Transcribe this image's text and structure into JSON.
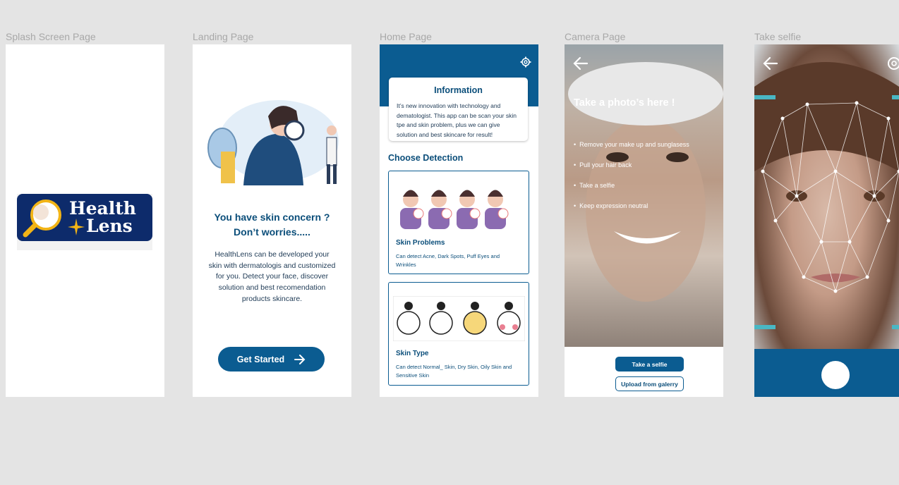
{
  "frames": {
    "splash": {
      "label": "Splash Screen Page",
      "logo_line1": "Health",
      "logo_line2": "Lens"
    },
    "landing": {
      "label": "Landing Page",
      "title_line1": "You have skin concern ?",
      "title_line2": "Don’t worries.....",
      "description": "HealthLens can be developed your skin with dermatologis and customized for you. Detect your face, discover solution and best recomendation products skincare.",
      "cta_label": "Get Started"
    },
    "home": {
      "label": "Home Page",
      "info_title": "Information",
      "info_text": "It’s new innovation with technology and dematologist. This app can be scan your skin tpe and skin problem, plus we can give solution and best skincare for result!",
      "choose_label": "Choose Detection",
      "cards": [
        {
          "title": "Skin Problems",
          "desc": "Can detect Acne, Dark Spots, Puff Eyes and Wrinkles"
        },
        {
          "title": "Skin Type",
          "desc": "Can detect Normal_ Skin, Dry Skin, Oily Skin and Sensitive Skin"
        }
      ]
    },
    "camera": {
      "label": "Camera Page",
      "title": "Take a photo’s here !",
      "tips": [
        "Remove your make up and sunglasess",
        "Pull your hair back",
        "Take a selfie",
        "Keep expression neutral"
      ],
      "primary_button": "Take a selfie",
      "secondary_button": "Upload from galerry"
    },
    "selfie": {
      "label": "Take selfie"
    }
  },
  "colors": {
    "primary": "#0b5c91",
    "dark_blue": "#0d2b6b",
    "canvas": "#e4e4e4"
  }
}
